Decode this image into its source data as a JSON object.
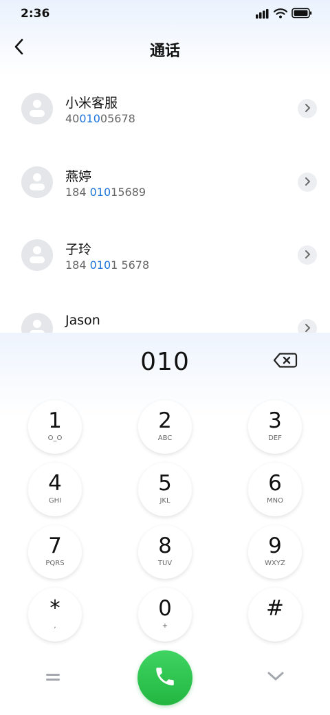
{
  "status_bar": {
    "time": "2:36"
  },
  "header": {
    "title": "通话"
  },
  "contacts": [
    {
      "name": "小米客服",
      "number_parts": [
        "40",
        "010",
        "05678"
      ]
    },
    {
      "name": "燕婷",
      "number_parts": [
        "184 ",
        "010",
        "15689"
      ]
    },
    {
      "name": "子玲",
      "number_parts": [
        "184 ",
        "010",
        "1 5678"
      ]
    },
    {
      "name": "Jason",
      "number_parts": [
        "",
        "",
        ""
      ]
    }
  ],
  "dialer": {
    "input": "010",
    "keys": [
      {
        "digit": "1",
        "letters": "O_O"
      },
      {
        "digit": "2",
        "letters": "ABC"
      },
      {
        "digit": "3",
        "letters": "DEF"
      },
      {
        "digit": "4",
        "letters": "GHI"
      },
      {
        "digit": "5",
        "letters": "JKL"
      },
      {
        "digit": "6",
        "letters": "MNO"
      },
      {
        "digit": "7",
        "letters": "PQRS"
      },
      {
        "digit": "8",
        "letters": "TUV"
      },
      {
        "digit": "9",
        "letters": "WXYZ"
      },
      {
        "digit": "*",
        "letters": ","
      },
      {
        "digit": "0",
        "letters": "+"
      },
      {
        "digit": "#",
        "letters": ""
      }
    ]
  },
  "icons": {
    "back": "chevron-left-icon",
    "detail": "chevron-right-icon",
    "delete": "backspace-icon",
    "menu": "equals-icon",
    "call": "phone-icon",
    "collapse": "chevron-down-icon"
  },
  "colors": {
    "highlight": "#1a73d9",
    "call_green": "#2bc44c"
  }
}
